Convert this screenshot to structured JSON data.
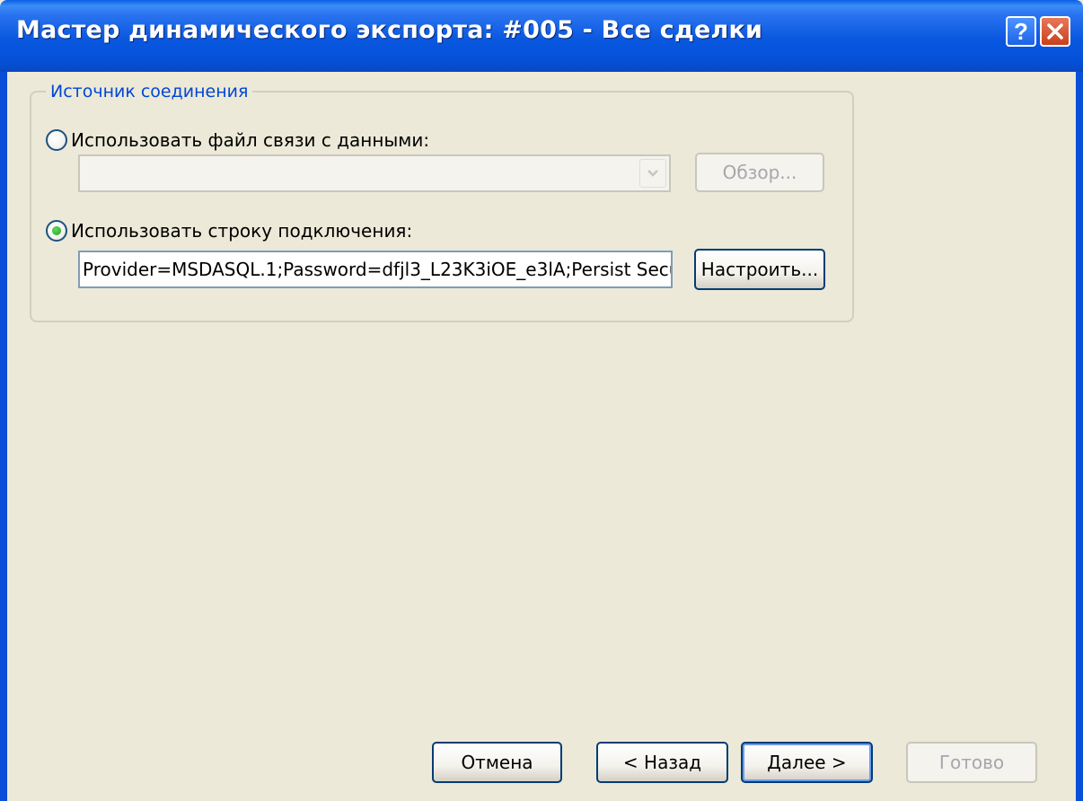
{
  "window": {
    "title": "Мастер динамического экспорта: #005 - Все сделки"
  },
  "connection_group": {
    "legend": "Источник соединения",
    "use_file_label": "Использовать файл связи с данными:",
    "file_value": "",
    "browse_label": "Обзор...",
    "use_string_label": "Использовать строку подключения:",
    "connection_string": "Provider=MSDASQL.1;Password=dfjl3_L23K3iOE_e3lA;Persist Security Info=True",
    "configure_label": "Настроить..."
  },
  "footer": {
    "cancel_label": "Отмена",
    "back_label": "< Назад",
    "next_label": "Далее >",
    "finish_label": "Готово"
  }
}
